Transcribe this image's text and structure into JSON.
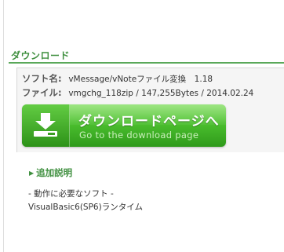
{
  "section": {
    "title": "ダウンロード"
  },
  "info": {
    "software_label": "ソフト名:",
    "software_value": "vMessage/vNoteファイル変換　1.18",
    "file_label": "ファイル:",
    "file_value": "vmgchg_118zip / 147,255Bytes / 2014.02.24"
  },
  "download_button": {
    "label": "ダウンロードページへ",
    "sublabel": "Go to the download page",
    "icon": "download-icon",
    "colors": {
      "top": "#7ddd5a",
      "bottom": "#2f9a1b"
    }
  },
  "extra": {
    "title": "追加説明",
    "lines": [
      "- 動作に必要なソフト -",
      "VisualBasic6(SP6)ランタイム"
    ]
  },
  "colors": {
    "accent": "#3f8f3f",
    "rule": "#5aa85a"
  }
}
